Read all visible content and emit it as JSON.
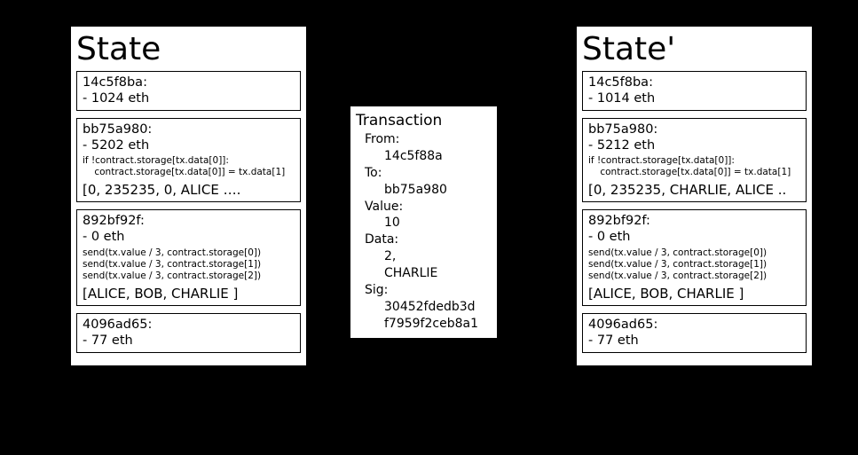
{
  "state_left": {
    "title": "State",
    "accounts": [
      {
        "hash": "14c5f8ba:",
        "balance": "- 1024 eth",
        "code": "",
        "storage": ""
      },
      {
        "hash": "bb75a980:",
        "balance": "- 5202 eth",
        "code": "if !contract.storage[tx.data[0]]:\n    contract.storage[tx.data[0]] = tx.data[1]",
        "storage": "[0, 235235, 0, ALICE …."
      },
      {
        "hash": "892bf92f:",
        "balance": "- 0 eth",
        "code": "send(tx.value / 3, contract.storage[0])\nsend(tx.value / 3, contract.storage[1])\nsend(tx.value / 3, contract.storage[2])",
        "storage": "[ALICE, BOB, CHARLIE ]"
      },
      {
        "hash": "4096ad65:",
        "balance": "- 77 eth",
        "code": "",
        "storage": ""
      }
    ]
  },
  "transaction": {
    "title": "Transaction",
    "from_label": "From:",
    "from_value": "14c5f88a",
    "to_label": "To:",
    "to_value": "bb75a980",
    "value_label": "Value:",
    "value_value": "10",
    "data_label": "Data:",
    "data_value1": "2,",
    "data_value2": "CHARLIE",
    "sig_label": "Sig:",
    "sig_value1": "30452fdedb3d",
    "sig_value2": "f7959f2ceb8a1"
  },
  "state_right": {
    "title": "State'",
    "accounts": [
      {
        "hash": "14c5f8ba:",
        "balance": "- 1014 eth",
        "code": "",
        "storage": ""
      },
      {
        "hash": "bb75a980:",
        "balance": "- 5212 eth",
        "code": "if !contract.storage[tx.data[0]]:\n    contract.storage[tx.data[0]] = tx.data[1]",
        "storage": "[0, 235235, CHARLIE, ALICE .."
      },
      {
        "hash": "892bf92f:",
        "balance": "- 0 eth",
        "code": "send(tx.value / 3, contract.storage[0])\nsend(tx.value / 3, contract.storage[1])\nsend(tx.value / 3, contract.storage[2])",
        "storage": "[ALICE, BOB, CHARLIE ]"
      },
      {
        "hash": "4096ad65:",
        "balance": "- 77 eth",
        "code": "",
        "storage": ""
      }
    ]
  }
}
